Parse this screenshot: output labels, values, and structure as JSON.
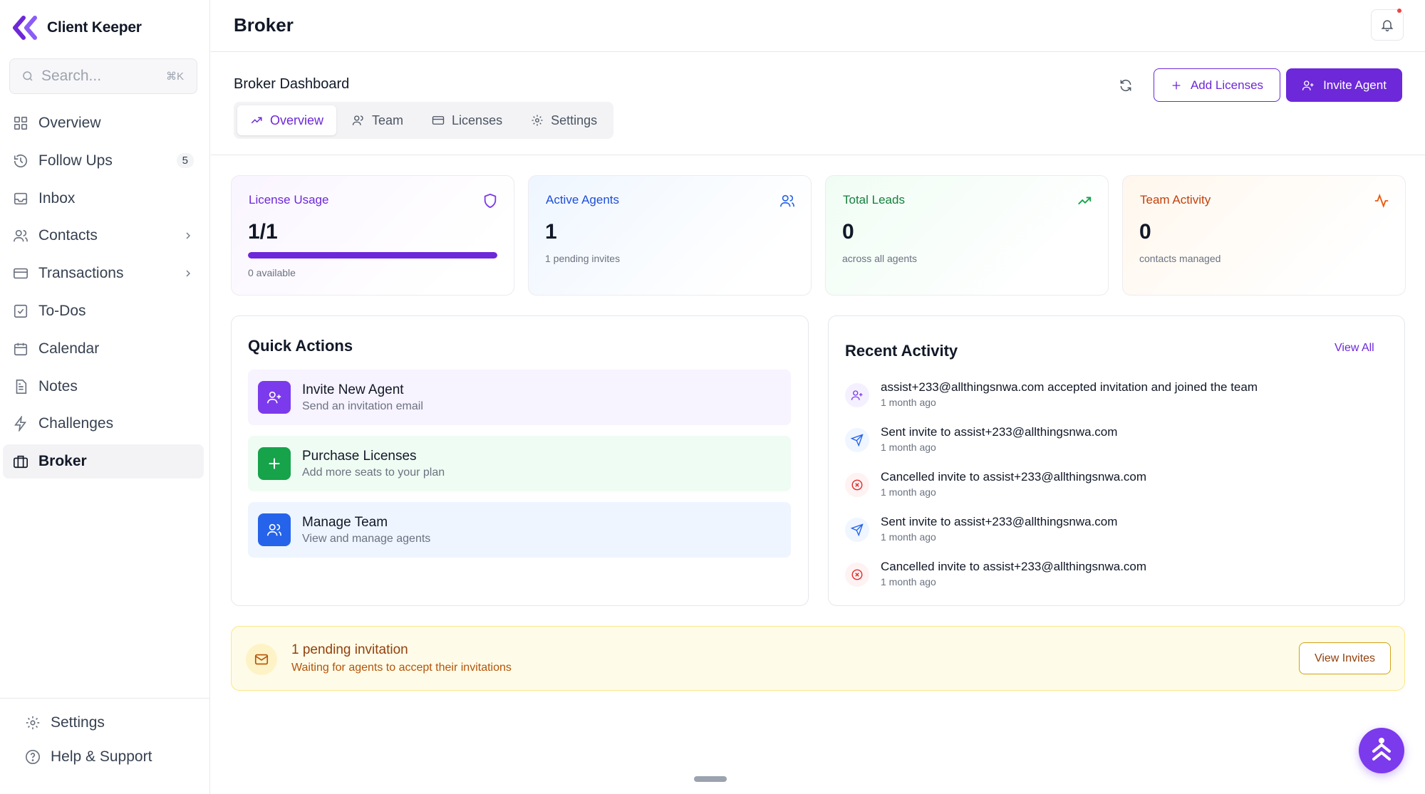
{
  "app": {
    "name": "Client Keeper",
    "accent": "#6d28d9"
  },
  "search": {
    "placeholder": "Search...",
    "shortcut": "⌘K"
  },
  "sidebar": {
    "items": [
      {
        "label": "Overview",
        "icon": "grid-icon"
      },
      {
        "label": "Follow Ups",
        "icon": "history-icon",
        "badge": "5"
      },
      {
        "label": "Inbox",
        "icon": "inbox-icon"
      },
      {
        "label": "Contacts",
        "icon": "users-icon"
      },
      {
        "label": "Transactions",
        "icon": "card-icon"
      },
      {
        "label": "To-Dos",
        "icon": "checkbox-icon"
      },
      {
        "label": "Calendar",
        "icon": "calendar-icon"
      },
      {
        "label": "Notes",
        "icon": "note-icon"
      },
      {
        "label": "Challenges",
        "icon": "bolt-icon"
      },
      {
        "label": "Broker",
        "icon": "briefcase-icon",
        "active": true
      }
    ],
    "footer": [
      {
        "label": "Settings",
        "icon": "gear-icon"
      },
      {
        "label": "Help & Support",
        "icon": "help-icon"
      }
    ]
  },
  "header": {
    "title": "Broker"
  },
  "dashboard": {
    "title": "Broker Dashboard",
    "tabs": [
      {
        "label": "Overview",
        "icon": "trend-icon",
        "active": true
      },
      {
        "label": "Team",
        "icon": "users-icon"
      },
      {
        "label": "Licenses",
        "icon": "card-icon"
      },
      {
        "label": "Settings",
        "icon": "gear-icon"
      }
    ],
    "add_licenses_label": "Add Licenses",
    "invite_agent_label": "Invite Agent"
  },
  "stats": {
    "license_usage": {
      "label": "License Usage",
      "value": "1/1",
      "sub": "0 available",
      "progress": 1.0,
      "color": "#6d28d9"
    },
    "active_agents": {
      "label": "Active Agents",
      "value": "1",
      "sub": "1 pending invites",
      "color": "#1d4ed8"
    },
    "total_leads": {
      "label": "Total Leads",
      "value": "0",
      "sub": "across all agents",
      "color": "#15803d"
    },
    "team_activity": {
      "label": "Team Activity",
      "value": "0",
      "sub": "contacts managed",
      "color": "#c2410c"
    }
  },
  "quick_actions": {
    "title": "Quick Actions",
    "items": [
      {
        "title": "Invite New Agent",
        "sub": "Send an invitation email",
        "color": "#7c3aed"
      },
      {
        "title": "Purchase Licenses",
        "sub": "Add more seats to your plan",
        "color": "#16a34a"
      },
      {
        "title": "Manage Team",
        "sub": "View and manage agents",
        "color": "#2563eb"
      }
    ]
  },
  "recent_activity": {
    "title": "Recent Activity",
    "view_all": "View All",
    "items": [
      {
        "text": "assist+233@allthingsnwa.com accepted invitation and joined the team",
        "time": "1 month ago",
        "kind": "joined"
      },
      {
        "text": "Sent invite to assist+233@allthingsnwa.com",
        "time": "1 month ago",
        "kind": "sent"
      },
      {
        "text": "Cancelled invite to assist+233@allthingsnwa.com",
        "time": "1 month ago",
        "kind": "cancelled"
      },
      {
        "text": "Sent invite to assist+233@allthingsnwa.com",
        "time": "1 month ago",
        "kind": "sent"
      },
      {
        "text": "Cancelled invite to assist+233@allthingsnwa.com",
        "time": "1 month ago",
        "kind": "cancelled"
      }
    ]
  },
  "pending_banner": {
    "title": "1 pending invitation",
    "sub": "Waiting for agents to accept their invitations",
    "button": "View Invites"
  }
}
